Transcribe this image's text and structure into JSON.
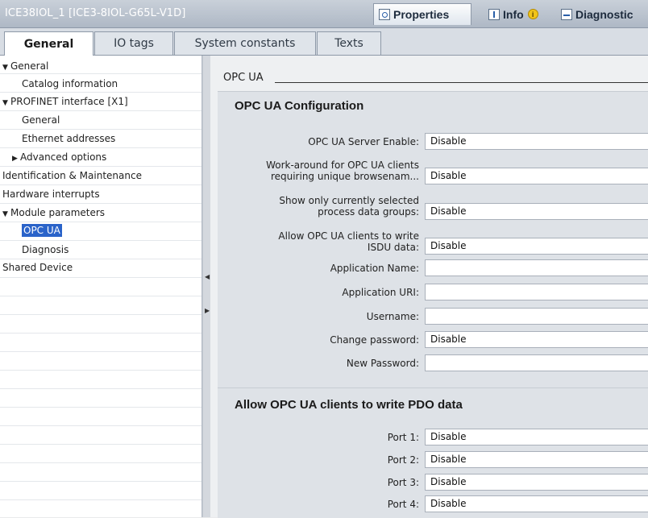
{
  "window": {
    "title": "ICE38IOL_1 [ICE3-8IOL-G65L-V1D]",
    "tabs": [
      {
        "label": "Properties",
        "icon": "properties-icon"
      },
      {
        "label": "Info",
        "icon": "info-icon"
      },
      {
        "label": "Diagnostic",
        "icon": "diagnostics-icon"
      }
    ],
    "info_badge": "i"
  },
  "subtabs": [
    "General",
    "IO tags",
    "System constants",
    "Texts"
  ],
  "tree": [
    {
      "label": "General",
      "expander": "▼"
    },
    {
      "label": "Catalog information",
      "expander": ""
    },
    {
      "label": "PROFINET interface [X1]",
      "expander": "▼"
    },
    {
      "label": "General",
      "expander": ""
    },
    {
      "label": "Ethernet addresses",
      "expander": ""
    },
    {
      "label": "Advanced options",
      "expander": "▶"
    },
    {
      "label": "Identification & Maintenance",
      "expander": ""
    },
    {
      "label": "Hardware interrupts",
      "expander": ""
    },
    {
      "label": "Module parameters",
      "expander": "▼"
    },
    {
      "label": "OPC UA",
      "expander": "",
      "selected": true
    },
    {
      "label": "Diagnosis",
      "expander": ""
    },
    {
      "label": "Shared Device",
      "expander": ""
    }
  ],
  "section": {
    "label": "OPC UA"
  },
  "config": {
    "title": "OPC UA Configuration",
    "rows": [
      {
        "label_lines": [
          "OPC UA Server Enable:"
        ],
        "value": "Disable"
      },
      {
        "label_lines": [
          "Work-around for OPC UA clients",
          "requiring unique browsenam..."
        ],
        "value": "Disable"
      },
      {
        "label_lines": [
          "Show only currently selected",
          "process data groups:"
        ],
        "value": "Disable"
      },
      {
        "label_lines": [
          "Allow OPC UA clients to write",
          "ISDU data:"
        ],
        "value": "Disable"
      },
      {
        "label_lines": [
          "Application Name:"
        ],
        "value": ""
      },
      {
        "label_lines": [
          "Application URI:"
        ],
        "value": ""
      },
      {
        "label_lines": [
          "Username:"
        ],
        "value": ""
      },
      {
        "label_lines": [
          "Change password:"
        ],
        "value": "Disable"
      },
      {
        "label_lines": [
          "New Password:"
        ],
        "value": ""
      }
    ]
  },
  "pdo": {
    "title": "Allow OPC UA clients to write PDO data",
    "rows": [
      {
        "label": "Port 1:",
        "value": "Disable"
      },
      {
        "label": "Port 2:",
        "value": "Disable"
      },
      {
        "label": "Port 3:",
        "value": "Disable"
      },
      {
        "label": "Port 4:",
        "value": "Disable"
      }
    ]
  }
}
